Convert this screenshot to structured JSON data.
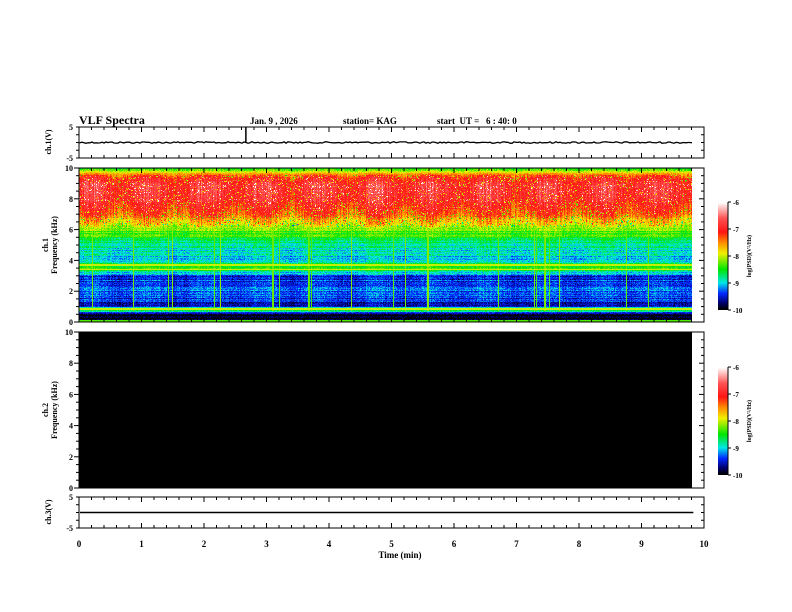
{
  "header": {
    "title": "VLF Spectra",
    "date": "Jan. 9 , 2026",
    "station": "station= KAG",
    "start": "start  UT =   6 : 40: 0"
  },
  "chart_data": {
    "type": "heatmap",
    "xlabel": "Time (min)",
    "xlim": [
      0,
      10
    ],
    "xticks": [
      "0",
      "1",
      "2",
      "3",
      "4",
      "5",
      "6",
      "7",
      "8",
      "9",
      "10"
    ],
    "data_end_min": 9.83,
    "panels": [
      {
        "id": "ch1-waveform",
        "type": "line",
        "ylabel": "ch.1(V)",
        "ylim": [
          -5,
          5
        ],
        "yticks": [
          "5",
          "-5"
        ],
        "baseline_v": 0,
        "spike_at_min": 2.67
      },
      {
        "id": "ch1-spectrogram",
        "type": "heatmap",
        "ylabel_line1": "ch.1",
        "ylabel_line2": "Frequency (kHz)",
        "ylim": [
          0,
          10
        ],
        "yticks": [
          "0",
          "2",
          "4",
          "6",
          "8",
          "10"
        ],
        "colorbar": {
          "label": "log(PSD)(V²/Hz)",
          "range": [
            -10,
            -6
          ],
          "ticks": [
            "-6",
            "-7",
            "-8",
            "-9",
            "-10"
          ]
        },
        "freq_profile_khz": [
          0,
          0.5,
          0.8,
          1,
          2,
          3,
          3.4,
          3.7,
          4,
          5,
          6,
          7,
          8,
          9,
          9.5,
          10
        ],
        "log_psd_profile": [
          -10,
          -9.9,
          -8.0,
          -9.6,
          -9.3,
          -9.4,
          -8.4,
          -8.3,
          -9.1,
          -8.8,
          -8.2,
          -7.3,
          -6.9,
          -6.8,
          -7.2,
          -8.5
        ]
      },
      {
        "id": "ch2-spectrogram",
        "type": "heatmap",
        "ylabel_line1": "ch.2",
        "ylabel_line2": "Frequency (kHz)",
        "ylim": [
          0,
          10
        ],
        "yticks": [
          "0",
          "2",
          "4",
          "6",
          "8",
          "10"
        ],
        "colorbar": {
          "label": "log(PSD)(V²/Hz)",
          "range": [
            -10,
            -6
          ],
          "ticks": [
            "-6",
            "-7",
            "-8",
            "-9",
            "-10"
          ]
        },
        "log_psd_uniform": -10
      },
      {
        "id": "ch3-waveform",
        "type": "line",
        "ylabel": "ch.3(V)",
        "ylim": [
          -5,
          5
        ],
        "yticks": [
          "5",
          "-5"
        ],
        "baseline_v": 0
      }
    ]
  }
}
